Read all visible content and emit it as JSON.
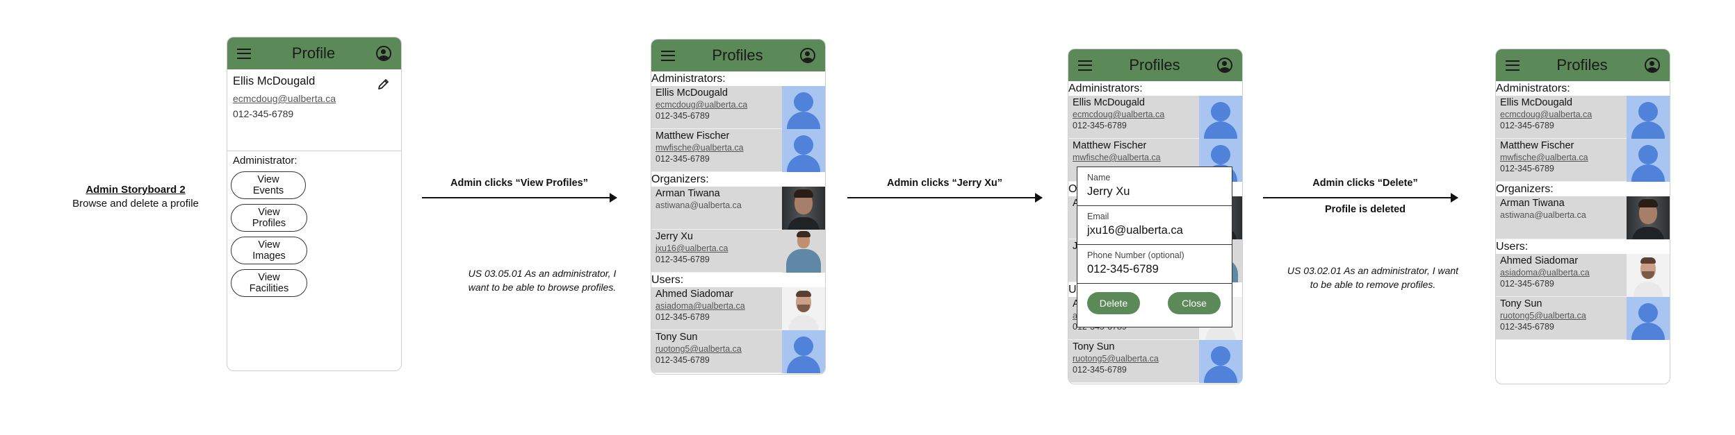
{
  "storyboard": {
    "title": "Admin Storyboard 2",
    "subtitle": "Browse and delete a profile"
  },
  "arrows": [
    {
      "label": "Admin clicks “View Profiles”",
      "note": "US 03.05.01 As an administrator, I want to be able to browse profiles."
    },
    {
      "label": "Admin clicks “Jerry Xu”"
    },
    {
      "label": "Admin clicks “Delete”",
      "sublabel": "Profile is deleted",
      "note": "US 03.02.01 As an administrator, I want to be able to remove profiles."
    }
  ],
  "screen1": {
    "title": "Profile",
    "name": "Ellis McDougald",
    "email": "ecmcdoug@ualberta.ca",
    "phone": "012-345-6789",
    "role": "Administrator:",
    "buttons": [
      "View Events",
      "View Profiles",
      "View Images",
      "View Facilities"
    ]
  },
  "screen2": {
    "title": "Profiles",
    "sections": [
      "Administrators:",
      "Organizers:",
      "Users:"
    ],
    "profiles": [
      {
        "name": "Ellis McDougald",
        "email": "ecmcdoug@ualberta.ca",
        "phone": "012-345-6789",
        "photo": "default-avatar"
      },
      {
        "name": "Matthew Fischer",
        "email": "mwfische@ualberta.ca",
        "phone": "012-345-6789",
        "photo": "default-avatar"
      },
      {
        "name": "Arman Tiwana",
        "email": "astiwana@ualberta.ca",
        "phone": "",
        "photo": "man-portrait"
      },
      {
        "name": "Jerry Xu",
        "email": "jxu16@ualberta.ca",
        "phone": "012-345-6789",
        "photo": "man-portrait"
      },
      {
        "name": "Ahmed Siadomar",
        "email": "asiadoma@ualberta.ca",
        "phone": "012-345-6789",
        "photo": "man-portrait"
      },
      {
        "name": "Tony Sun",
        "email": "ruotong5@ualberta.ca",
        "phone": "012-345-6789",
        "photo": "default-avatar"
      }
    ]
  },
  "screen3": {
    "title": "Profiles",
    "visible_section_letters": [
      "O",
      "J",
      "U",
      "A"
    ],
    "dialog": {
      "name_label": "Name",
      "name_value": "Jerry Xu",
      "email_label": "Email",
      "email_value": "jxu16@ualberta.ca",
      "phone_label": "Phone Number (optional)",
      "phone_value": "012-345-6789",
      "delete_label": "Delete",
      "close_label": "Close"
    }
  },
  "screen4": {
    "title": "Profiles"
  },
  "colors": {
    "accent": "#5b8a58",
    "row_bg": "#d8d8d8",
    "avatar_bg": "#a8c4f0",
    "avatar_fg": "#4f82d8"
  }
}
